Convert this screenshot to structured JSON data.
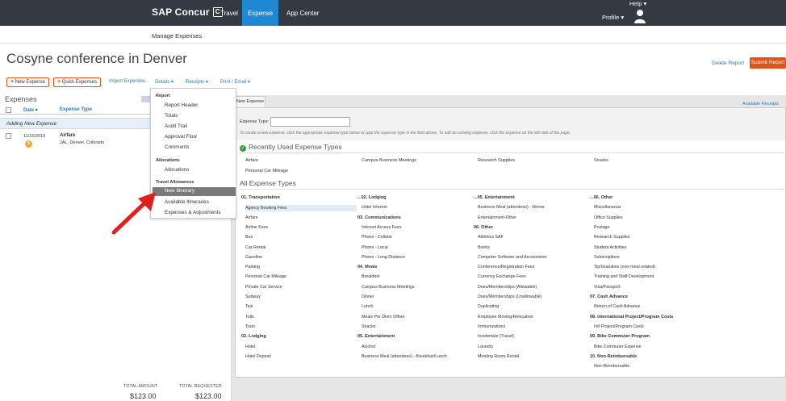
{
  "topbar": {
    "brand": "SAP Concur",
    "brand_icon": "C",
    "nav": [
      "Travel",
      "Expense",
      "App Center"
    ],
    "help": "Help ▾",
    "profile": "Profile ▾"
  },
  "subnav": {
    "manage": "Manage Expenses"
  },
  "report": {
    "title": "Cosyne conference in Denver",
    "delete": "Delete Report",
    "submit": "Submit Report"
  },
  "toolbar": {
    "new_expense": "New Expense",
    "quick_expenses": "Quick Expenses",
    "import_expenses": "Import Expenses",
    "details": "Details ▾",
    "receipts": "Receipts ▾",
    "print_email": "Print / Email ▾"
  },
  "expenses": {
    "title": "Expenses",
    "col_date": "Date ▾",
    "col_type": "Expense Type",
    "adding": "Adding New Expense",
    "rows": [
      {
        "date": "11/15/2019",
        "title": "Airfare",
        "sub": "JAL, Denver, Colorado",
        "icon": "credit-card-icon"
      }
    ],
    "total_amount_label": "TOTAL AMOUNT",
    "total_amount": "$123.00",
    "total_requested_label": "TOTAL REQUESTED",
    "total_requested": "$123.00"
  },
  "details_menu": {
    "report_head": "Report",
    "report_items": [
      "Report Header",
      "Totals",
      "Audit Trail",
      "Approval Flow",
      "Comments"
    ],
    "alloc_head": "Allocations",
    "alloc_items": [
      "Allocations"
    ],
    "travel_head": "Travel Allowances",
    "travel_items": [
      "New Itinerary",
      "Available Itineraries",
      "Expenses & Adjustments"
    ],
    "active_item": "New Itinerary"
  },
  "main": {
    "tab": "New Expense",
    "available_receipts": "Available Receipts",
    "expense_type_label": "Expense Type:",
    "expense_type_value": "",
    "hint": "To create a new expense, click the appropriate expense type below or type the expense type in the field above. To edit an existing expense, click the expense on the left side of the page.",
    "recent_title": "Recently Used Expense Types",
    "recent": [
      [
        "Airfare",
        "Personal Car Mileage"
      ],
      [
        "Campus Business Meetings"
      ],
      [
        "Research Supplies"
      ],
      [
        "Snacks"
      ]
    ],
    "all_title": "All Expense Types",
    "columns": [
      [
        {
          "cat": "01. Transportation"
        },
        {
          "item": "Agency Booking Fees",
          "hl": true
        },
        {
          "item": "Airfare"
        },
        {
          "item": "Airline Fees"
        },
        {
          "item": "Bus"
        },
        {
          "item": "Car Rental"
        },
        {
          "item": "Gasoline"
        },
        {
          "item": "Parking"
        },
        {
          "item": "Personal Car Mileage"
        },
        {
          "item": "Private Car Service"
        },
        {
          "item": "Subway"
        },
        {
          "item": "Taxi"
        },
        {
          "item": "Tolls"
        },
        {
          "item": "Train"
        },
        {
          "cat": "02. Lodging"
        },
        {
          "item": "Hotel"
        },
        {
          "item": "Hotel Deposit"
        }
      ],
      [
        {
          "cat": "...02. Lodging"
        },
        {
          "item": "Hotel Internet"
        },
        {
          "cat": "03. Communications"
        },
        {
          "item": "Internet Access Fees"
        },
        {
          "item": "Phone - Cellular"
        },
        {
          "item": "Phone - Local"
        },
        {
          "item": "Phone - Long Distance"
        },
        {
          "cat": "04. Meals"
        },
        {
          "item": "Breakfast"
        },
        {
          "item": "Campus Business Meetings"
        },
        {
          "item": "Dinner"
        },
        {
          "item": "Lunch"
        },
        {
          "item": "Meals Per Diem Offset"
        },
        {
          "item": "Snacks"
        },
        {
          "cat": "05. Entertainment"
        },
        {
          "item": "Alcohol"
        },
        {
          "item": "Business Meal (attendees) - Breakfast/Lunch"
        }
      ],
      [
        {
          "cat": "...05. Entertainment"
        },
        {
          "item": "Business Meal (attendees) - Dinner"
        },
        {
          "item": "Entertainment-Other"
        },
        {
          "cat": "06. Other"
        },
        {
          "item": "Athletics SAF"
        },
        {
          "item": "Books"
        },
        {
          "item": "Computer Software and Accessories"
        },
        {
          "item": "Conference/Registration Fees"
        },
        {
          "item": "Currency Exchange Fees"
        },
        {
          "item": "Dues/Memberships (Allowable)"
        },
        {
          "item": "Dues/Memberships (Unallowable)"
        },
        {
          "item": "Duplicating"
        },
        {
          "item": "Employee Moving/Relocation"
        },
        {
          "item": "Immunizations"
        },
        {
          "item": "Incidentals (Travel)"
        },
        {
          "item": "Laundry"
        },
        {
          "item": "Meeting Room Rental"
        }
      ],
      [
        {
          "cat": "...06. Other"
        },
        {
          "item": "Miscellaneous"
        },
        {
          "item": "Office Supplies"
        },
        {
          "item": "Postage"
        },
        {
          "item": "Research Supplies"
        },
        {
          "item": "Student Activities"
        },
        {
          "item": "Subscriptions"
        },
        {
          "item": "Tip/Gratuities (non-meal related)"
        },
        {
          "item": "Training and Staff Development"
        },
        {
          "item": "Visa/Passport"
        },
        {
          "cat": "07. Cash Advance"
        },
        {
          "item": "Return of Cash Advance"
        },
        {
          "cat": "08. International Project/Program Costs"
        },
        {
          "item": "Intl Project/Program Costs"
        },
        {
          "cat": "09. Bike Commuter Program"
        },
        {
          "item": "Bike Commuter Expense"
        },
        {
          "cat": "10. Non-Reimbursable"
        },
        {
          "item": "Non-Reimbursable"
        }
      ]
    ]
  },
  "colors": {
    "topbar": "#333a42",
    "active_nav": "#1e88d2",
    "accent_orange": "#e0531d",
    "link_blue": "#2a7bbf",
    "annotation_arrow": "#e0201b"
  }
}
